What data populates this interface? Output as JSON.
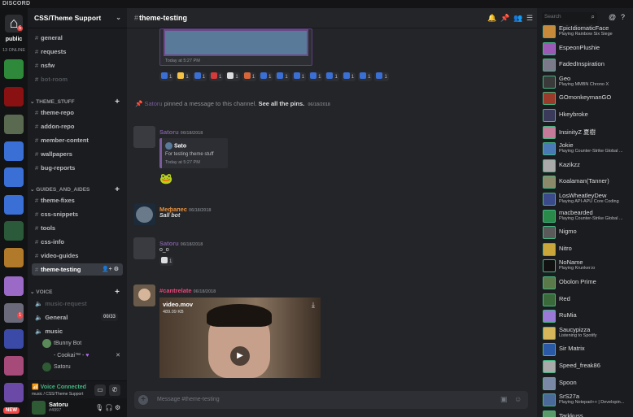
{
  "window": {
    "title": "DISCORD"
  },
  "guilds": {
    "home_label": "public",
    "home_badge": "5",
    "online_text": "13 ONLINE",
    "new_badge": "NEW",
    "icon_badge": "1",
    "items": [
      {
        "name": "html5-server",
        "color": "#2e8a3a"
      },
      {
        "name": "red-logo-server",
        "color": "#8a1111"
      },
      {
        "name": "landscape-server",
        "color": "#5a6a50"
      },
      {
        "name": "blue-nine-server",
        "color": "#3a6fd6"
      },
      {
        "name": "blue-nine-server-2",
        "color": "#3a6fd6"
      },
      {
        "name": "braces-server",
        "color": "#3a6fd6"
      },
      {
        "name": "green-art-server",
        "color": "#2a5a3a"
      },
      {
        "name": "gold-art-server",
        "color": "#b07a2a"
      },
      {
        "name": "rainbow-server",
        "color": "#9a6ac6"
      },
      {
        "name": "anime-server",
        "color": "#6a6a7a"
      },
      {
        "name": "blue-art-server",
        "color": "#3a4aa6"
      },
      {
        "name": "pink-art-server",
        "color": "#a64a7a"
      },
      {
        "name": "purple-art-server",
        "color": "#6a4aa6"
      },
      {
        "name": "gaming-server",
        "color": "#2a5a8a"
      },
      {
        "name": "skeletor-server",
        "color": "#b08a1a"
      }
    ]
  },
  "server": {
    "name": "CSS/Theme Support",
    "channels_top": [
      {
        "name": "general",
        "muted": false
      },
      {
        "name": "requests",
        "muted": false
      },
      {
        "name": "nsfw",
        "muted": false
      },
      {
        "name": "bot-room",
        "muted": true
      }
    ],
    "cat_theme": "THEME_STUFF",
    "channels_theme": [
      "theme-repo",
      "addon-repo",
      "member-content",
      "wallpapers",
      "bug-reports"
    ],
    "cat_guides": "GUIDES_AND_AIDES",
    "channels_guides": [
      "theme-fixes",
      "css-snippets",
      "tools",
      "css-info",
      "video-guides",
      "theme-testing"
    ],
    "cat_voice": "VOICE",
    "voice_muted": "music-request",
    "voice_general": "General",
    "voice_general_count": "00/33",
    "voice_music": "music",
    "voice_users": [
      "tBunny Bot",
      "- Cookai™ -",
      "Satoru"
    ],
    "voice_connected": "Voice Connected",
    "voice_sub": "music / CSS/Theme Support",
    "user_name": "Satoru",
    "user_tag": "#4997"
  },
  "chat": {
    "channel": "theme-testing",
    "embed_time": "Today at 5:27 PM",
    "reactions": [
      "1",
      "1",
      "1",
      "1",
      "1",
      "1",
      "1",
      "1",
      "1",
      "1",
      "1",
      "1",
      "1",
      "1",
      "1",
      "2"
    ],
    "pin_user": "Satoru",
    "pin_text": "pinned a message to this channel.",
    "pin_link": "See all the pins.",
    "pin_date": "06/18/2018",
    "m1_user": "Satoru",
    "m1_time": "06/18/2018",
    "m1_embed_user": "Sato",
    "m1_embed_text": "For testing theme stuff",
    "m1_embed_time": "Today at 5:27 PM",
    "m2_user": "Мефапес",
    "m2_time": "06/18/2018",
    "m2_text": "Sall bot",
    "m3_user": "Satoru",
    "m3_time": "06/18/2018",
    "m3_text": "o_o",
    "m3_react_count": "1",
    "m4_user": "#cantrelate",
    "m4_time": "06/18/2018",
    "video_name": "video.mov",
    "video_size": "489.09 KB",
    "input_placeholder": "Message #theme-testing"
  },
  "members": {
    "search_placeholder": "Search",
    "list": [
      {
        "name": "EpicIdiomaticFace",
        "status": "Playing Rainbow Six Siege",
        "color": "#c68a3a"
      },
      {
        "name": "EspeonPlushie",
        "status": "",
        "color": "#9a5ab6"
      },
      {
        "name": "FadedInspiration",
        "status": "",
        "color": "#7a7a8a"
      },
      {
        "name": "Geo",
        "status": "Playing MMBN Chrono X",
        "color": "#3a3a3a"
      },
      {
        "name": "GOmonkeymanGO",
        "status": "",
        "color": "#9a3a2a"
      },
      {
        "name": "Hkeybroke",
        "status": "",
        "color": "#3a3a5a"
      },
      {
        "name": "InsinityZ 夏樹",
        "status": "",
        "color": "#c67a9a"
      },
      {
        "name": "Jokie",
        "status": "Playing Counter-Strike Global ...",
        "color": "#4a7ab6"
      },
      {
        "name": "Kazikzz",
        "status": "",
        "color": "#aaaaaa"
      },
      {
        "name": "Koalaman(Tanner)",
        "status": "",
        "color": "#8a8a6a"
      },
      {
        "name": "LosWheatleyDew",
        "status": "Playing API-APU Core Coding",
        "color": "#3a4a8a"
      },
      {
        "name": "macbearded",
        "status": "Playing Counter-Strike Global ...",
        "color": "#2a8a4a"
      },
      {
        "name": "Nigmo",
        "status": "",
        "color": "#5a5a5a"
      },
      {
        "name": "Nitro",
        "status": "",
        "color": "#caa63a"
      },
      {
        "name": "NoName",
        "status": "Playing Krunker.io",
        "color": "#111111"
      },
      {
        "name": "Obolon Prime",
        "status": "",
        "color": "#5a7a4a"
      },
      {
        "name": "Red",
        "status": "",
        "color": "#3a6a3a"
      },
      {
        "name": "RuMia",
        "status": "",
        "color": "#9a7ad6"
      },
      {
        "name": "Saucypizza",
        "status": "Listening to Spotify",
        "color": "#d6b65a"
      },
      {
        "name": "Sir Matrix",
        "status": "",
        "color": "#2a5aa6"
      },
      {
        "name": "Speed_freak86",
        "status": "",
        "color": "#aaaaaa"
      },
      {
        "name": "Spoon",
        "status": "",
        "color": "#7a8aa6"
      },
      {
        "name": "SrS27a",
        "status": "Playing Notepad++ | Developin...",
        "color": "#4a6a9a"
      },
      {
        "name": "Tarkkuss",
        "status": "",
        "color": "#5a9a6a"
      }
    ]
  }
}
